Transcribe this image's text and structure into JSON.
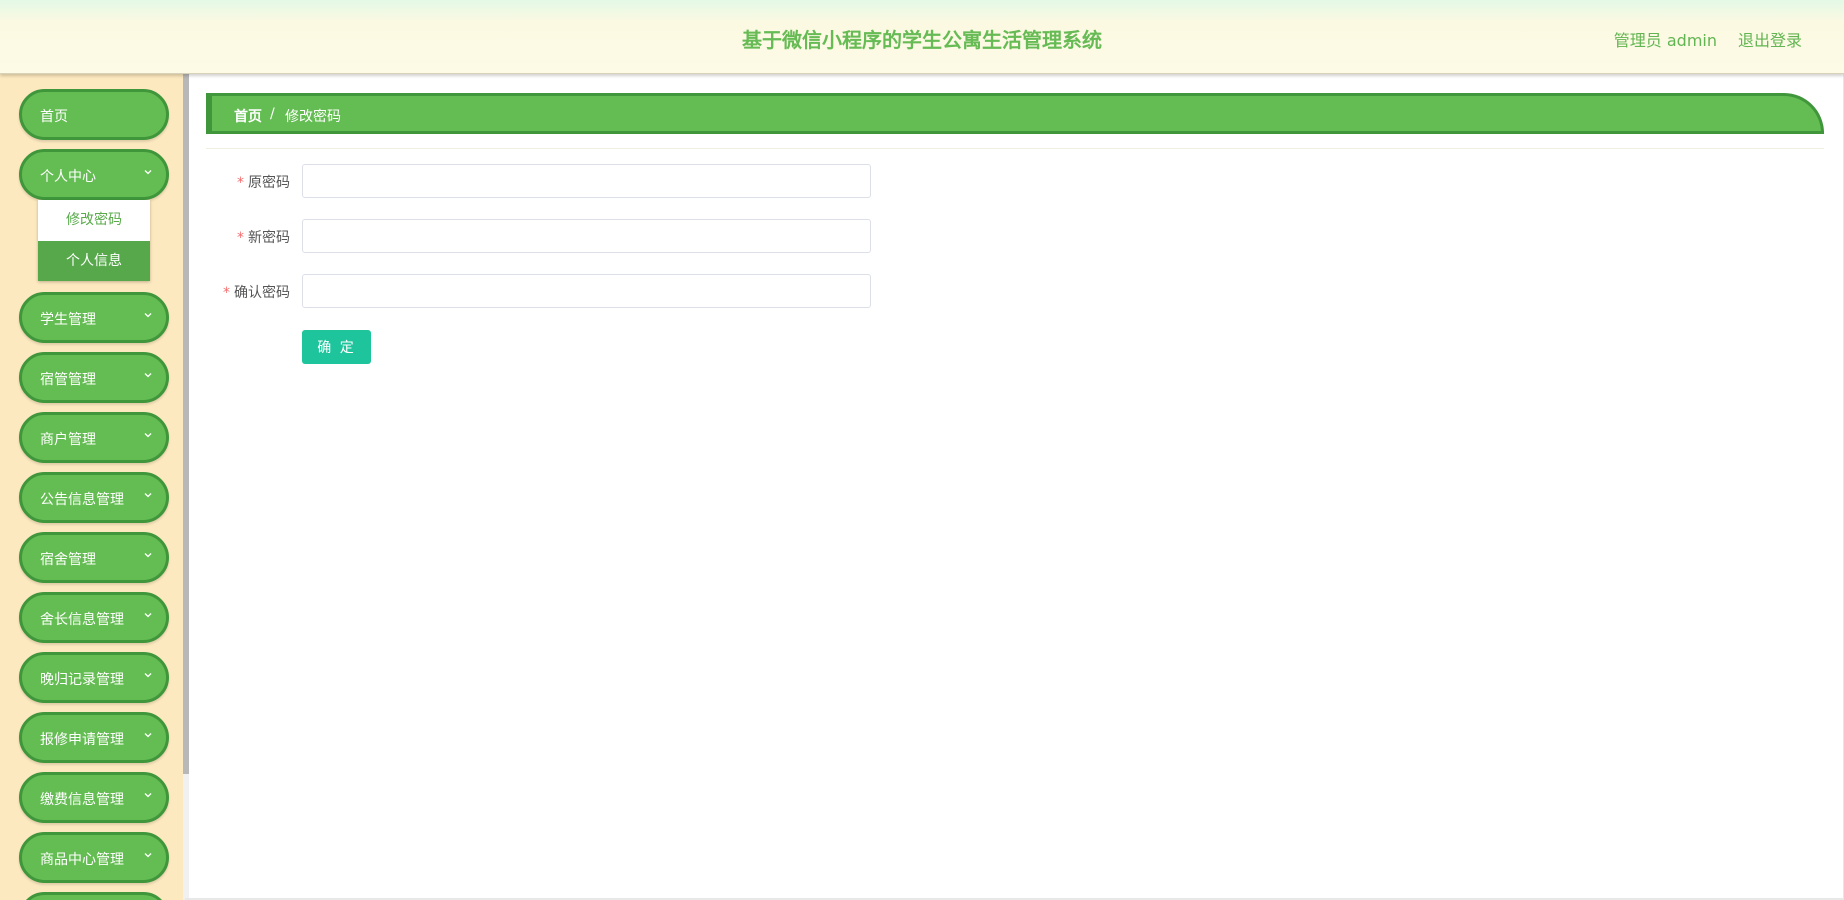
{
  "header": {
    "title": "基于微信小程序的学生公寓生活管理系统",
    "user": "管理员 admin",
    "logout": "退出登录"
  },
  "sidebar": {
    "items": [
      {
        "label": "首页",
        "has_children": false
      },
      {
        "label": "个人中心",
        "has_children": true,
        "expanded": true
      },
      {
        "label": "学生管理",
        "has_children": true
      },
      {
        "label": "宿管管理",
        "has_children": true
      },
      {
        "label": "商户管理",
        "has_children": true
      },
      {
        "label": "公告信息管理",
        "has_children": true
      },
      {
        "label": "宿舍管理",
        "has_children": true
      },
      {
        "label": "舍长信息管理",
        "has_children": true
      },
      {
        "label": "晚归记录管理",
        "has_children": true
      },
      {
        "label": "报修申请管理",
        "has_children": true
      },
      {
        "label": "缴费信息管理",
        "has_children": true
      },
      {
        "label": "商品中心管理",
        "has_children": true
      }
    ],
    "submenu": [
      {
        "label": "修改密码",
        "active": true
      },
      {
        "label": "个人信息",
        "active": false
      }
    ]
  },
  "breadcrumb": {
    "home": "首页",
    "separator": "/",
    "current": "修改密码"
  },
  "form": {
    "fields": [
      {
        "label": "原密码",
        "required": true,
        "value": ""
      },
      {
        "label": "新密码",
        "required": true,
        "value": ""
      },
      {
        "label": "确认密码",
        "required": true,
        "value": ""
      }
    ],
    "submit": "确 定"
  },
  "colors": {
    "primary_green": "#64bd52",
    "border_green": "#3f963b",
    "sidebar_bg": "#fde9bf",
    "button_teal": "#1ec49c",
    "required_red": "#f56c6c"
  }
}
